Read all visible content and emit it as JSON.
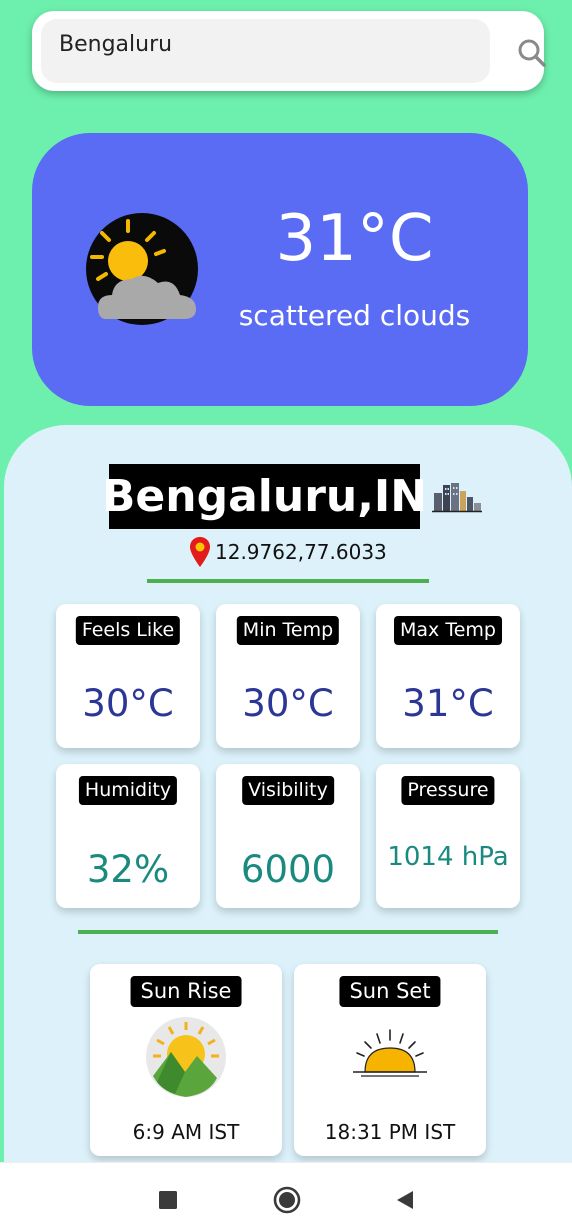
{
  "search": {
    "value": "Bengaluru",
    "icon": "search-icon"
  },
  "current": {
    "temperature": "31°C",
    "description": "scattered clouds",
    "icon": "sun-cloud-icon"
  },
  "location": {
    "city": "Bengaluru,IN",
    "coordinates": "12.9762,77.6033"
  },
  "stats": [
    {
      "label": "Feels Like",
      "value": "30°C"
    },
    {
      "label": "Min Temp",
      "value": "30°C"
    },
    {
      "label": "Max Temp",
      "value": "31°C"
    },
    {
      "label": "Humidity",
      "value": "32%"
    },
    {
      "label": "Visibility",
      "value": "6000"
    },
    {
      "label": "Pressure",
      "value": "1014 hPa"
    }
  ],
  "sun": {
    "rise": {
      "label": "Sun Rise",
      "time": "6:9 AM IST"
    },
    "set": {
      "label": "Sun Set",
      "time": "18:31 PM IST"
    }
  },
  "colors": {
    "background": "#6df0ad",
    "weather_card": "#5a6cf4",
    "info_panel": "#dcf1fa",
    "divider": "#4caf50",
    "temp_value": "#2c3694",
    "teal_value": "#1a8a80"
  },
  "nav": {
    "icons": [
      "recents-square-icon",
      "home-circle-icon",
      "back-triangle-icon"
    ]
  }
}
